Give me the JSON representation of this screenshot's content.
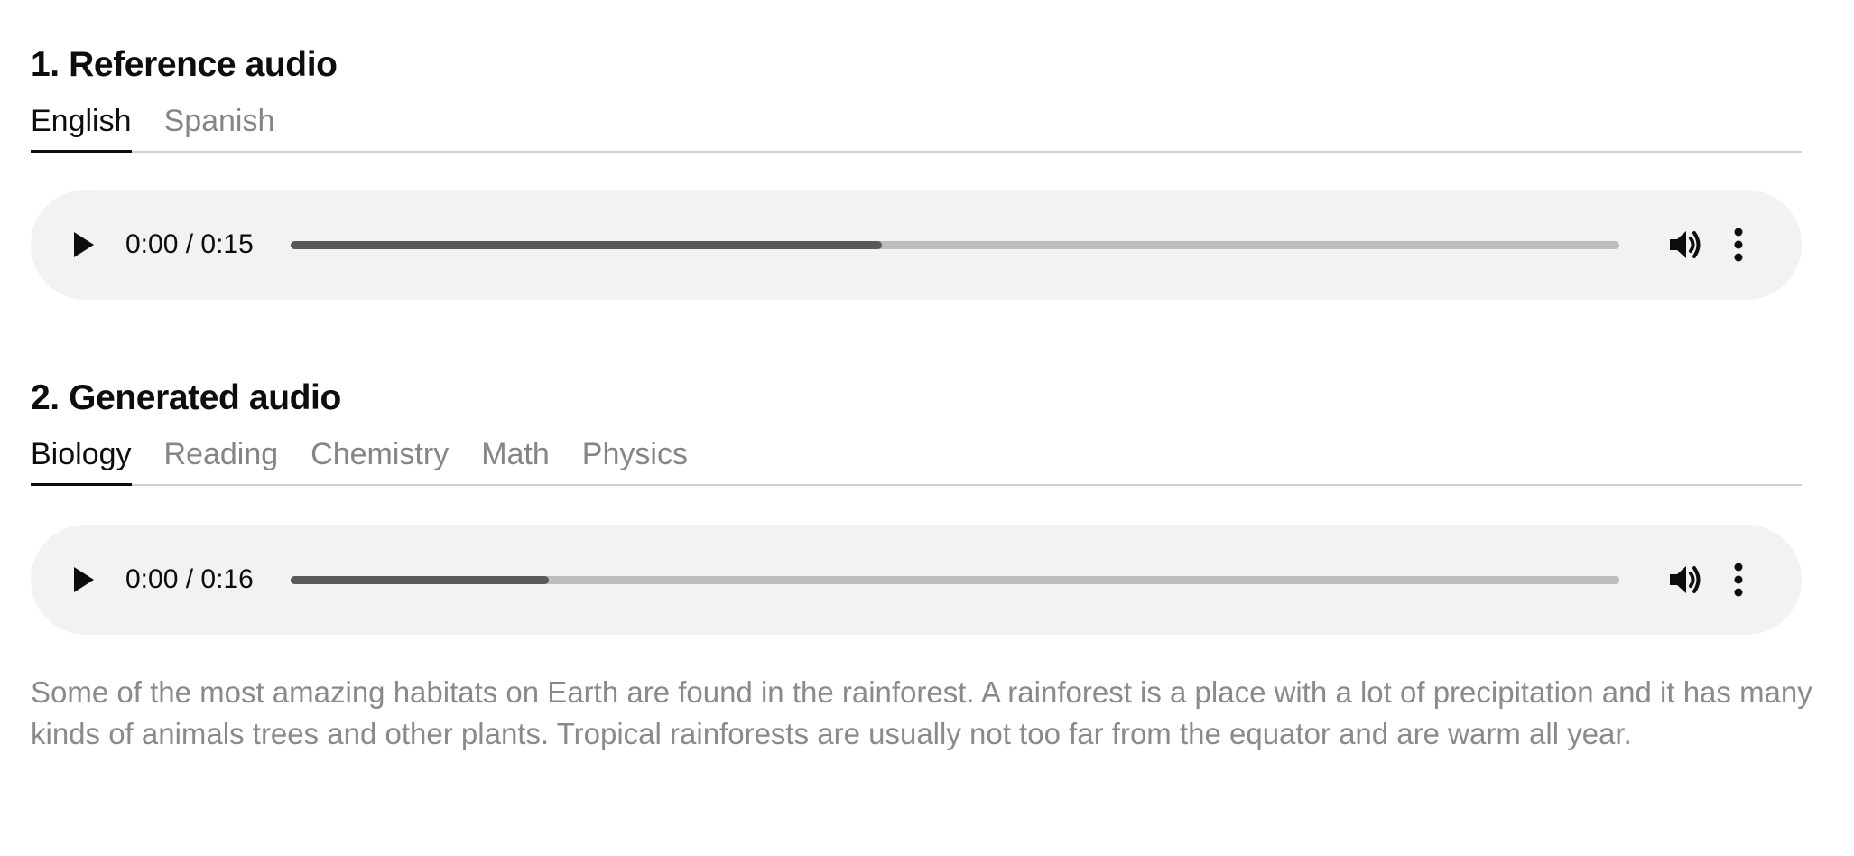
{
  "reference": {
    "title": "1. Reference audio",
    "tabs": [
      {
        "label": "English",
        "active": true
      },
      {
        "label": "Spanish",
        "active": false
      }
    ],
    "player": {
      "time": "0:00 / 0:15",
      "progress_fraction": 0.445
    }
  },
  "generated": {
    "title": "2. Generated audio",
    "tabs": [
      {
        "label": "Biology",
        "active": true
      },
      {
        "label": "Reading",
        "active": false
      },
      {
        "label": "Chemistry",
        "active": false
      },
      {
        "label": "Math",
        "active": false
      },
      {
        "label": "Physics",
        "active": false
      }
    ],
    "player": {
      "time": "0:00 / 0:16",
      "progress_fraction": 0.194
    },
    "transcript": "Some of the most amazing habitats on Earth are found in the rainforest. A rainforest is a place with a lot of precipitation and it has many kinds of animals trees and other plants. Tropical rainforests are usually not too far from the equator and are warm all year."
  },
  "icons": {
    "play": "play-icon",
    "volume": "volume-icon",
    "more": "more-vertical-icon"
  },
  "colors": {
    "text": "#0d0d0d",
    "muted_text": "#858585",
    "player_bg": "#f1f2f3",
    "track": "#bdbdbd",
    "track_fill": "#595959",
    "divider": "#d0d0d0"
  }
}
